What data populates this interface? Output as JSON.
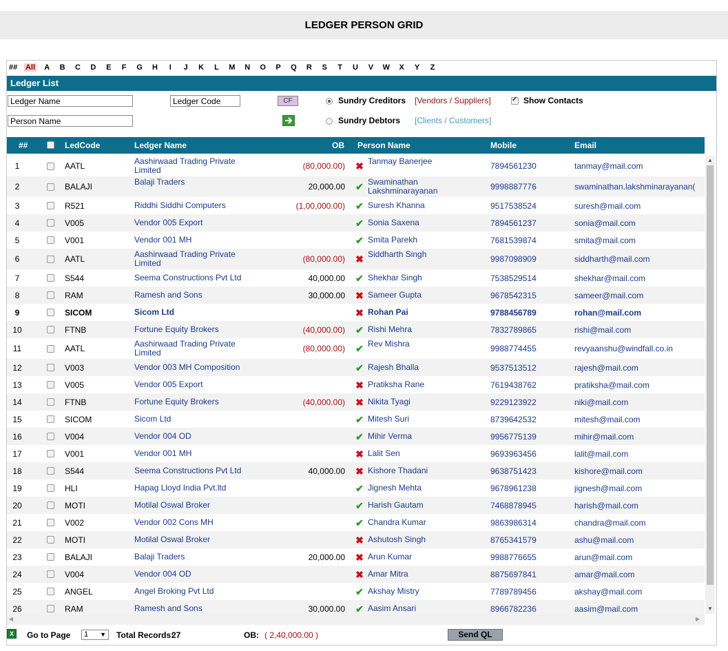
{
  "header": {
    "title": "LEDGER PERSON GRID"
  },
  "alphabet": {
    "hash": "##",
    "all": "All",
    "letters": [
      "A",
      "B",
      "C",
      "D",
      "E",
      "F",
      "G",
      "H",
      "I",
      "J",
      "K",
      "L",
      "M",
      "N",
      "O",
      "P",
      "Q",
      "R",
      "S",
      "T",
      "U",
      "V",
      "W",
      "X",
      "Y",
      "Z"
    ]
  },
  "list_title": "Ledger List",
  "filters": {
    "ledger_name_value": "Ledger Name",
    "ledger_code_value": "Ledger Code",
    "person_name_value": "Person Name",
    "cf_label": "CF",
    "sundry_creditors": "Sundry Creditors",
    "creditors_note": "[Vendors / Suppliers]",
    "sundry_debtors": "Sundry Debtors",
    "debtors_note": "[Clients / Customers]",
    "show_contacts": "Show Contacts",
    "colors": {
      "creditors_note": "#8a1010",
      "debtors_note": "#4a9ac0"
    }
  },
  "grid": {
    "columns": {
      "num": "##",
      "code": "LedCode",
      "name": "Ledger Name",
      "ob": "OB",
      "person": "Person Name",
      "mobile": "Mobile",
      "email": "Email"
    },
    "rows": [
      {
        "n": "1",
        "code": "AATL",
        "name": "Aashirwaad Trading Private Limited",
        "ob": "(80,000.00)",
        "neg": true,
        "ok": false,
        "person": "Tanmay Banerjee",
        "mobile": "7894561230",
        "email": "tanmay@mail.com",
        "h": 2
      },
      {
        "n": "2",
        "code": "BALAJI",
        "name": "Balaji Traders",
        "ob": "20,000.00",
        "neg": false,
        "ok": true,
        "person": "Swaminathan Lakshminarayanan",
        "mobile": "9998887776",
        "email": "swaminathan.lakshminarayanan(",
        "h": 2
      },
      {
        "n": "3",
        "code": "R521",
        "name": "Riddhi Siddhi Computers",
        "ob": "(1,00,000.00)",
        "neg": true,
        "ok": true,
        "person": "Suresh Khanna",
        "mobile": "9517538524",
        "email": "suresh@mail.com",
        "h": 1
      },
      {
        "n": "4",
        "code": "V005",
        "name": "Vendor 005 Export",
        "ob": "",
        "neg": false,
        "ok": true,
        "person": "Sonia Saxena",
        "mobile": "7894561237",
        "email": "sonia@mail.com",
        "h": 1
      },
      {
        "n": "5",
        "code": "V001",
        "name": "Vendor 001 MH",
        "ob": "",
        "neg": false,
        "ok": true,
        "person": "Smita Parekh",
        "mobile": "7681539874",
        "email": "smita@mail.com",
        "h": 1
      },
      {
        "n": "6",
        "code": "AATL",
        "name": "Aashirwaad Trading Private Limited",
        "ob": "(80,000.00)",
        "neg": true,
        "ok": false,
        "person": "Siddharth Singh",
        "mobile": "9987098909",
        "email": "siddharth@mail.com",
        "h": 2
      },
      {
        "n": "7",
        "code": "S544",
        "name": "Seema Constructions Pvt Ltd",
        "ob": "40,000.00",
        "neg": false,
        "ok": true,
        "person": "Shekhar Singh",
        "mobile": "7538529514",
        "email": "shekhar@mail.com",
        "h": 1
      },
      {
        "n": "8",
        "code": "RAM",
        "name": "Ramesh and Sons",
        "ob": "30,000.00",
        "neg": false,
        "ok": false,
        "person": "Sameer Gupta",
        "mobile": "9678542315",
        "email": "sameer@mail.com",
        "h": 1
      },
      {
        "n": "9",
        "code": "SICOM",
        "name": "Sicom Ltd",
        "ob": "",
        "neg": false,
        "ok": false,
        "person": "Rohan Pai",
        "mobile": "9788456789",
        "email": "rohan@mail.com",
        "h": 1,
        "bold": true
      },
      {
        "n": "10",
        "code": "FTNB",
        "name": "Fortune Equity Brokers",
        "ob": "(40,000.00)",
        "neg": true,
        "ok": true,
        "person": "Rishi Mehra",
        "mobile": "7832789865",
        "email": "rishi@mail.com",
        "h": 1
      },
      {
        "n": "11",
        "code": "AATL",
        "name": "Aashirwaad Trading Private Limited",
        "ob": "(80,000.00)",
        "neg": true,
        "ok": true,
        "person": "Rev Mishra",
        "mobile": "9988774455",
        "email": "revyaanshu@windfall.co.in",
        "h": 2
      },
      {
        "n": "12",
        "code": "V003",
        "name": "Vendor 003 MH Composition",
        "ob": "",
        "neg": false,
        "ok": true,
        "person": "Rajesh Bhalla",
        "mobile": "9537513512",
        "email": "rajesh@mail.com",
        "h": 1
      },
      {
        "n": "13",
        "code": "V005",
        "name": "Vendor 005 Export",
        "ob": "",
        "neg": false,
        "ok": false,
        "person": "Pratiksha Rane",
        "mobile": "7619438762",
        "email": "pratiksha@mail.com",
        "h": 1
      },
      {
        "n": "14",
        "code": "FTNB",
        "name": "Fortune Equity Brokers",
        "ob": "(40,000.00)",
        "neg": true,
        "ok": false,
        "person": "Nikita Tyagi",
        "mobile": "9229123922",
        "email": "niki@mail.com",
        "h": 1
      },
      {
        "n": "15",
        "code": "SICOM",
        "name": "Sicom Ltd",
        "ob": "",
        "neg": false,
        "ok": true,
        "person": "Mitesh Suri",
        "mobile": "8739642532",
        "email": "mitesh@mail.com",
        "h": 1
      },
      {
        "n": "16",
        "code": "V004",
        "name": "Vendor 004 OD",
        "ob": "",
        "neg": false,
        "ok": true,
        "person": "Mihir Verma",
        "mobile": "9956775139",
        "email": "mihir@mail.com",
        "h": 1
      },
      {
        "n": "17",
        "code": "V001",
        "name": "Vendor 001 MH",
        "ob": "",
        "neg": false,
        "ok": false,
        "person": "Lalit Sen",
        "mobile": "9693963456",
        "email": "lalit@mail.com",
        "h": 1
      },
      {
        "n": "18",
        "code": "S544",
        "name": "Seema Constructions Pvt Ltd",
        "ob": "40,000.00",
        "neg": false,
        "ok": false,
        "person": "Kishore Thadani",
        "mobile": "9638751423",
        "email": "kishore@mail.com",
        "h": 1
      },
      {
        "n": "19",
        "code": "HLI",
        "name": "Hapag Lloyd India Pvt.ltd",
        "ob": "",
        "neg": false,
        "ok": true,
        "person": "Jignesh Mehta",
        "mobile": "9678961238",
        "email": "jignesh@mail.com",
        "h": 1
      },
      {
        "n": "20",
        "code": "MOTI",
        "name": "Motilal Oswal Broker",
        "ob": "",
        "neg": false,
        "ok": true,
        "person": "Harish Gautam",
        "mobile": "7468878945",
        "email": "harish@mail.com",
        "h": 1
      },
      {
        "n": "21",
        "code": "V002",
        "name": "Vendor 002 Cons MH",
        "ob": "",
        "neg": false,
        "ok": true,
        "person": "Chandra Kumar",
        "mobile": "9863986314",
        "email": "chandra@mail.com",
        "h": 1
      },
      {
        "n": "22",
        "code": "MOTI",
        "name": "Motilal Oswal Broker",
        "ob": "",
        "neg": false,
        "ok": false,
        "person": "Ashutosh Singh",
        "mobile": "8765341579",
        "email": "ashu@mail.com",
        "h": 1
      },
      {
        "n": "23",
        "code": "BALAJI",
        "name": "Balaji Traders",
        "ob": "20,000.00",
        "neg": false,
        "ok": false,
        "person": "Arun Kumar",
        "mobile": "9988776655",
        "email": "arun@mail.com",
        "h": 1
      },
      {
        "n": "24",
        "code": "V004",
        "name": "Vendor 004 OD",
        "ob": "",
        "neg": false,
        "ok": false,
        "person": "Amar Mitra",
        "mobile": "8875697841",
        "email": "amar@mail.com",
        "h": 1
      },
      {
        "n": "25",
        "code": "ANGEL",
        "name": "Angel Broking Pvt Ltd",
        "ob": "",
        "neg": false,
        "ok": true,
        "person": "Akshay Mistry",
        "mobile": "7789789456",
        "email": "akshay@mail.com",
        "h": 1
      },
      {
        "n": "26",
        "code": "RAM",
        "name": "Ramesh and Sons",
        "ob": "30,000.00",
        "neg": false,
        "ok": true,
        "person": "Aasim Ansari",
        "mobile": "8966782236",
        "email": "aasim@mail.com",
        "h": 1
      }
    ]
  },
  "footer": {
    "go_to_page": "Go to Page",
    "page_value": "1",
    "total_records_label": "Total Records:",
    "total_records": "27",
    "ob_label": "OB:",
    "ob_value": "( 2,40,000.00 )",
    "send_ql": "Send QL"
  }
}
